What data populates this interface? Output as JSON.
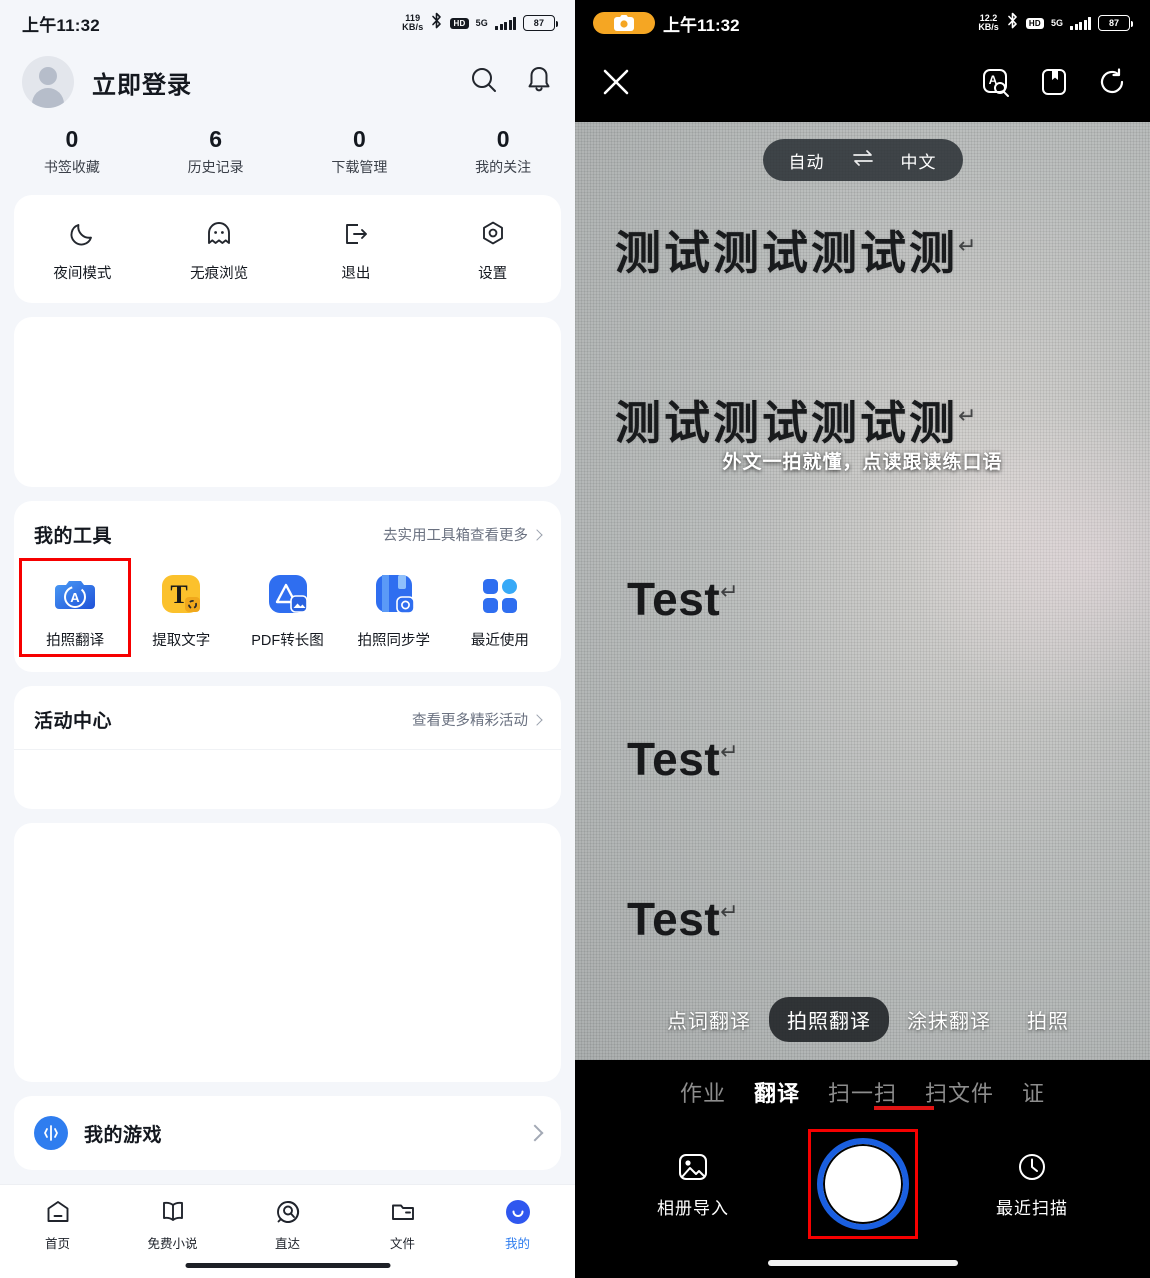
{
  "left": {
    "statusbar": {
      "time": "上午11:32",
      "net_speed_value": "119",
      "net_speed_unit": "KB/s",
      "bluetooth_icon": "bluetooth-icon",
      "hd_label": "HD",
      "network_label": "5G",
      "battery_level": "87"
    },
    "header": {
      "login_label": "立即登录",
      "search_icon": "search-icon",
      "bell_icon": "bell-icon"
    },
    "stats": [
      {
        "value": "0",
        "label": "书签收藏"
      },
      {
        "value": "6",
        "label": "历史记录"
      },
      {
        "value": "0",
        "label": "下载管理"
      },
      {
        "value": "0",
        "label": "我的关注"
      }
    ],
    "quick_actions": [
      {
        "label": "夜间模式",
        "icon": "moon-icon"
      },
      {
        "label": "无痕浏览",
        "icon": "ghost-icon"
      },
      {
        "label": "退出",
        "icon": "exit-icon"
      },
      {
        "label": "设置",
        "icon": "gear-icon"
      }
    ],
    "tools_section": {
      "title": "我的工具",
      "more_label": "去实用工具箱查看更多",
      "chevron_icon": "chevron-right-icon",
      "items": [
        {
          "label": "拍照翻译",
          "icon": "camera-translate-icon",
          "highlighted": true
        },
        {
          "label": "提取文字",
          "icon": "extract-text-icon",
          "highlighted": false
        },
        {
          "label": "PDF转长图",
          "icon": "pdf-to-image-icon",
          "highlighted": false
        },
        {
          "label": "拍照同步学",
          "icon": "photo-study-icon",
          "highlighted": false
        },
        {
          "label": "最近使用",
          "icon": "recent-grid-icon",
          "highlighted": false
        }
      ]
    },
    "activity_section": {
      "title": "活动中心",
      "more_label": "查看更多精彩活动",
      "chevron_icon": "chevron-right-icon"
    },
    "games_section": {
      "label": "我的游戏",
      "icon": "game-controller-icon",
      "chevron_icon": "chevron-right-icon"
    },
    "bottom_nav": [
      {
        "label": "首页",
        "icon": "home-icon",
        "active": false
      },
      {
        "label": "免费小说",
        "icon": "book-icon",
        "active": false
      },
      {
        "label": "直达",
        "icon": "direct-search-icon",
        "active": false
      },
      {
        "label": "文件",
        "icon": "folder-icon",
        "active": false
      },
      {
        "label": "我的",
        "icon": "profile-icon",
        "active": true
      }
    ],
    "accent_color": "#2f7def"
  },
  "right": {
    "statusbar": {
      "camera_indicator_icon": "camera-active-icon",
      "time": "上午11:32",
      "net_speed_value": "12.2",
      "net_speed_unit": "KB/s",
      "bluetooth_icon": "bluetooth-icon",
      "hd_label": "HD",
      "network_label": "5G",
      "battery_level": "87"
    },
    "topbar": {
      "close_icon": "close-icon",
      "icons": [
        {
          "icon": "text-search-icon"
        },
        {
          "icon": "dictionary-bookmark-icon"
        },
        {
          "icon": "refresh-rotate-icon"
        }
      ]
    },
    "language_bar": {
      "source": "自动",
      "swap_icon": "swap-arrows-icon",
      "target": "中文"
    },
    "viewfinder": {
      "captured_lines": [
        "测试测试测试测",
        "测试测试测试测",
        "Test",
        "Test",
        "Test"
      ],
      "paragraph_mark": "↵",
      "hint": "外文一拍就懂，点读跟读练口语"
    },
    "modes": [
      {
        "label": "点词翻译",
        "selected": false
      },
      {
        "label": "拍照翻译",
        "selected": true
      },
      {
        "label": "涂抹翻译",
        "selected": false
      },
      {
        "label": "拍照",
        "selected": false
      }
    ],
    "tabs": [
      {
        "label": "作业",
        "active": false
      },
      {
        "label": "翻译",
        "active": true
      },
      {
        "label": "扫一扫",
        "active": false
      },
      {
        "label": "扫文件",
        "active": false
      },
      {
        "label": "证",
        "active": false
      }
    ],
    "actions": {
      "album_label": "相册导入",
      "album_icon": "album-import-icon",
      "shutter_icon": "shutter-button",
      "shutter_highlighted": true,
      "recent_label": "最近扫描",
      "recent_icon": "clock-icon"
    },
    "accent_color": "#1a5fe0",
    "highlight_color": "#f60000"
  }
}
